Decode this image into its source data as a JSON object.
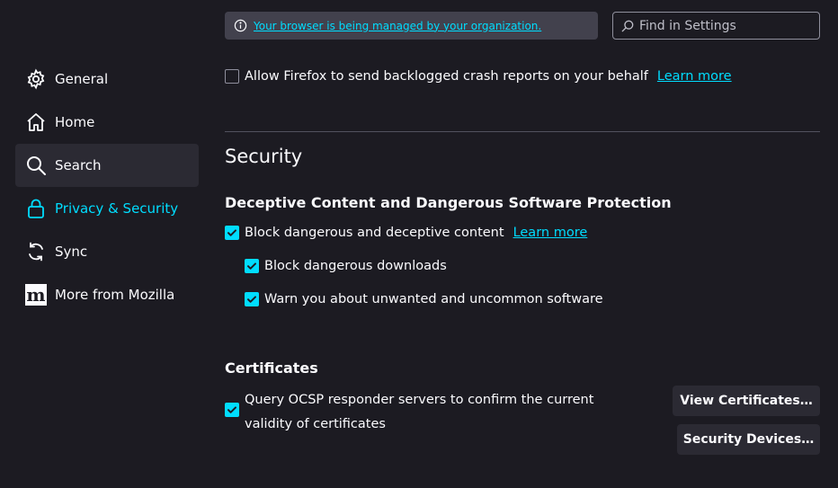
{
  "policy_notice": {
    "text": "Your browser is being managed by your organization."
  },
  "search": {
    "placeholder": "Find in Settings"
  },
  "sidebar": {
    "items": [
      {
        "label": "General",
        "icon": "gear-icon"
      },
      {
        "label": "Home",
        "icon": "home-icon"
      },
      {
        "label": "Search",
        "icon": "search-icon"
      },
      {
        "label": "Privacy & Security",
        "icon": "lock-icon"
      },
      {
        "label": "Sync",
        "icon": "sync-icon"
      },
      {
        "label": "More from Mozilla",
        "icon": "mozilla-logo-icon"
      }
    ],
    "selected": "Privacy & Security",
    "hovered": "Search",
    "mozilla_logo_text": "m"
  },
  "crash_reports": {
    "label": "Allow Firefox to send backlogged crash reports on your behalf",
    "checked": false,
    "learn_more": "Learn more"
  },
  "security": {
    "title": "Security",
    "deceptive": {
      "heading": "Deceptive Content and Dangerous Software Protection",
      "block_content": {
        "label": "Block dangerous and deceptive content",
        "checked": true,
        "learn_more": "Learn more"
      },
      "block_downloads": {
        "label": "Block dangerous downloads",
        "checked": true
      },
      "warn_unwanted": {
        "label": "Warn you about unwanted and uncommon software",
        "checked": true
      }
    },
    "certificates": {
      "heading": "Certificates",
      "ocsp": {
        "label": "Query OCSP responder servers to confirm the current validity of certificates",
        "checked": true
      },
      "view_button": "View Certificates…",
      "devices_button": "Security Devices…"
    }
  },
  "colors": {
    "accent": "#00ddff",
    "background": "#1c1b22",
    "surface": "#2b2a33"
  }
}
